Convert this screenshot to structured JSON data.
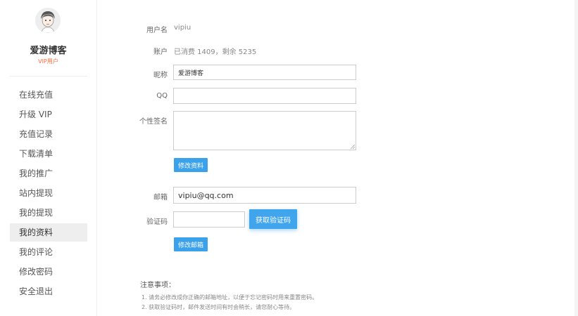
{
  "user": {
    "name": "爱游博客",
    "badge": "VIP用户"
  },
  "sidebar": {
    "items": [
      {
        "label": "在线充值",
        "active": false
      },
      {
        "label": "升级 VIP",
        "active": false
      },
      {
        "label": "充值记录",
        "active": false
      },
      {
        "label": "下载清单",
        "active": false
      },
      {
        "label": "我的推广",
        "active": false
      },
      {
        "label": "站内提现",
        "active": false
      },
      {
        "label": "我的提现",
        "active": false
      },
      {
        "label": "我的资料",
        "active": true
      },
      {
        "label": "我的评论",
        "active": false
      },
      {
        "label": "修改密码",
        "active": false
      },
      {
        "label": "安全退出",
        "active": false
      }
    ]
  },
  "profile": {
    "username_label": "用户名",
    "username_value": "vipiu",
    "account_label": "账户",
    "account_value": "已消费 1409，剩余 5235",
    "nickname_label": "昵称",
    "nickname_value": "爱游博客",
    "qq_label": "QQ",
    "qq_value": "",
    "signature_label": "个性签名",
    "signature_value": "",
    "save_button": "修改资料"
  },
  "email": {
    "email_label": "邮箱",
    "email_value": "vipiu@qq.com",
    "code_label": "验证码",
    "code_value": "",
    "get_code_button": "获取验证码",
    "change_email_button": "修改邮箱"
  },
  "notes": {
    "title": "注意事项：",
    "items": [
      "1. 请务必修改成你正确的邮箱地址，以便于忘记密码时用来重置密码。",
      "2. 获取验证码时，邮件发送时间有时会稍长，请您耐心等待。"
    ]
  },
  "colors": {
    "accent": "#3aa1ea",
    "vip": "#ff6a3c",
    "active_bg": "#eeeeee"
  }
}
